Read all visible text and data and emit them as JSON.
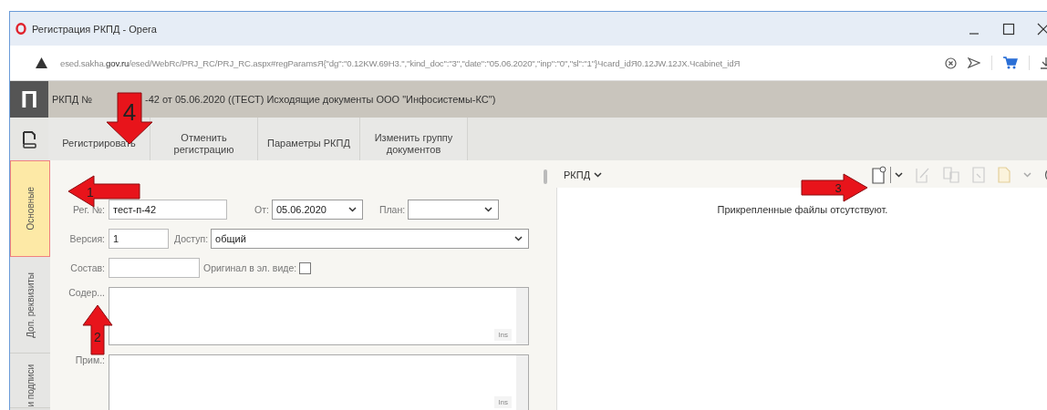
{
  "window": {
    "title": "Регистрация РКПД - Opera"
  },
  "address_bar": {
    "url": "esed.sakha.**gov.ru**/esed/WebRc/PRJ_RC/PRJ_RC.aspx#regParamsЯ{\"dg\":\"0.12KW.69H3.\",\"kind_doc\":\"3\",\"date\":\"05.06.2020\",\"inp\":\"0\",\"sl\":\"1\"}Чcard_idЯ0.12JW.12JX.Чcabinet_idЯ"
  },
  "app_header": {
    "logo": "П",
    "title_start": "РКПД №",
    "title_end": "-42 от 05.06.2020 ((ТЕСТ) Исходящие документы ООО \"Инфосистемы-КС\")"
  },
  "toolbar": {
    "buttons": [
      {
        "label": "Регистрировать"
      },
      {
        "label": "Отменить регистрацию"
      },
      {
        "label": "Параметры РКПД"
      },
      {
        "label": "Изменить группу документов"
      }
    ]
  },
  "side_tabs": [
    {
      "label": "Основные",
      "selected": true
    },
    {
      "label": "Доп. реквизиты",
      "selected": false
    },
    {
      "label": "и подписи",
      "selected": false
    }
  ],
  "form": {
    "reg_no": {
      "label": "Рег. №:",
      "value": "тест-п-42"
    },
    "date": {
      "label": "От:",
      "value": "05.06.2020"
    },
    "plan": {
      "label": "План:"
    },
    "version": {
      "label": "Версия:",
      "value": "1"
    },
    "access": {
      "label": "Доступ:",
      "value": "общий"
    },
    "composition": {
      "label": "Состав:"
    },
    "original": {
      "label": "Оригинал в эл. виде:",
      "checked": false
    },
    "content": {
      "label": "Содер...",
      "ins": "Ins"
    },
    "note": {
      "label": "Прим.:",
      "ins": "Ins"
    }
  },
  "attachments": {
    "menu": "РКПД",
    "empty_message": "Прикрепленные файлы отсутствуют."
  },
  "annotations": [
    {
      "number": "1",
      "kind": "left"
    },
    {
      "number": "2",
      "kind": "up"
    },
    {
      "number": "3",
      "kind": "right"
    },
    {
      "number": "4",
      "kind": "down"
    }
  ]
}
